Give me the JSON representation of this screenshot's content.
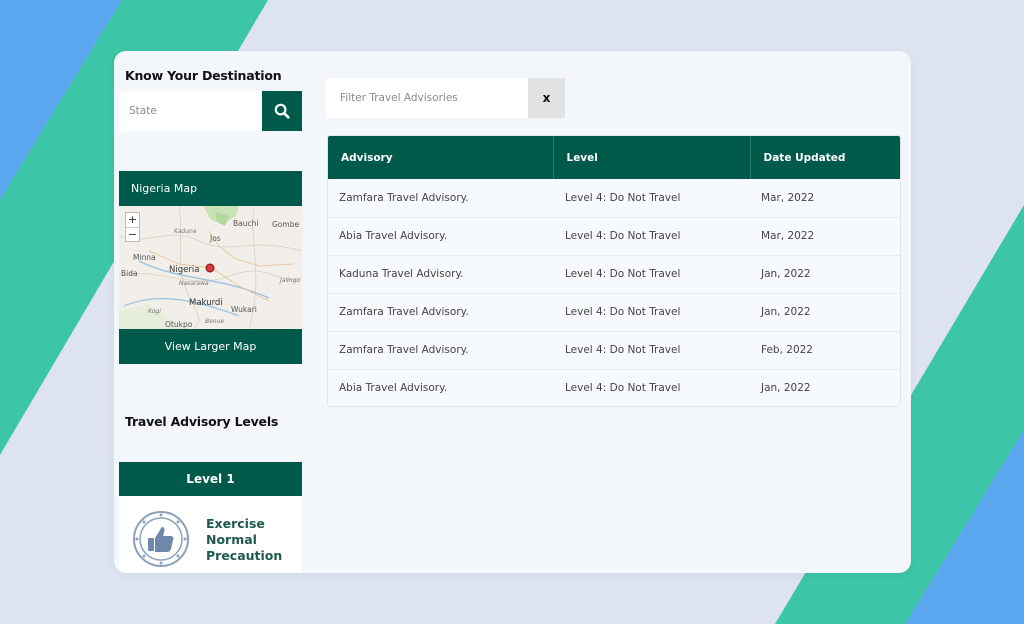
{
  "sidebar": {
    "destination_title": "Know Your Destination",
    "state_placeholder": "State",
    "search_icon": "search-icon",
    "map": {
      "header": "Nigeria Map",
      "zoom_in": "+",
      "zoom_out": "−",
      "labels": {
        "bauchi": "Bauchi",
        "gombe": "Gombe",
        "kaduna": "Kaduna",
        "jos": "Jos",
        "minna": "Minna",
        "nigeria": "Nigeria",
        "bida": "Bida",
        "nasarawa": "Nasarawa",
        "jalingo": "Jalingo",
        "makurdi": "Makurdi",
        "wukari": "Wukari",
        "kogi": "Kogi",
        "otukpo": "Otukpo",
        "benue": "Benue"
      },
      "larger_map_label": "View Larger Map"
    },
    "levels_title": "Travel Advisory Levels",
    "level": {
      "header": "Level 1",
      "text": "Exercise Normal Precaution",
      "icon": "thumbs-up-icon"
    }
  },
  "filter": {
    "placeholder": "Filter Travel Advisories",
    "clear_label": "x"
  },
  "table": {
    "headers": [
      "Advisory",
      "Level",
      "Date Updated"
    ],
    "rows": [
      {
        "advisory": "Zamfara Travel Advisory.",
        "level": "Level 4: Do Not Travel",
        "date": "Mar, 2022"
      },
      {
        "advisory": "Abia Travel Advisory.",
        "level": "Level 4: Do Not Travel",
        "date": "Mar, 2022"
      },
      {
        "advisory": "Kaduna Travel Advisory.",
        "level": "Level 4: Do Not Travel",
        "date": "Jan, 2022"
      },
      {
        "advisory": "Zamfara Travel Advisory.",
        "level": "Level 4: Do Not Travel",
        "date": "Jan, 2022"
      },
      {
        "advisory": "Zamfara Travel Advisory.",
        "level": "Level 4: Do Not Travel",
        "date": "Feb, 2022"
      },
      {
        "advisory": "Abia Travel Advisory.",
        "level": "Level 4: Do Not Travel",
        "date": "Jan, 2022"
      }
    ]
  },
  "colors": {
    "brand_green": "#005a4b",
    "background": "#dde3ef",
    "stripe_teal": "#3cc5a6",
    "stripe_blue": "#5aa7ef",
    "card": "#f3f7fb"
  }
}
